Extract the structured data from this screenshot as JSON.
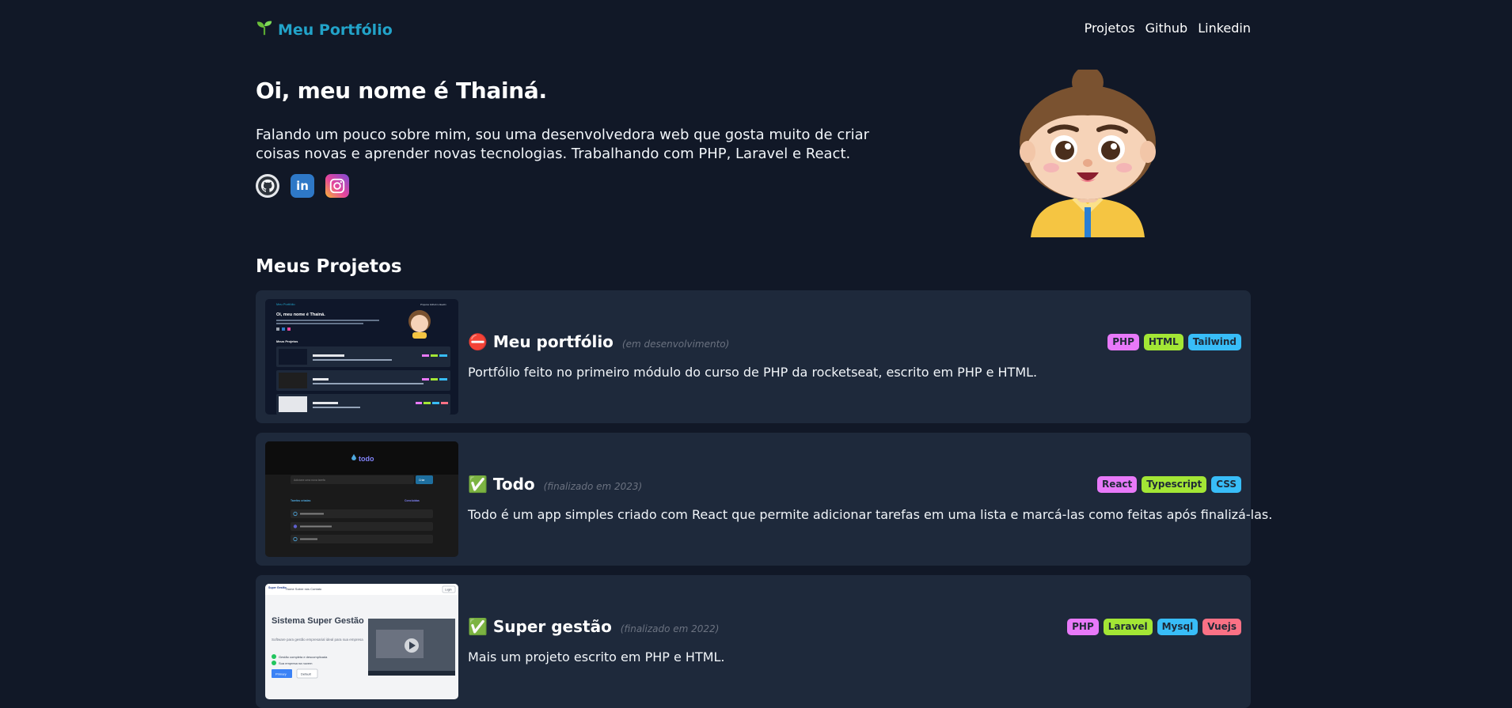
{
  "header": {
    "logo_text": "Meu Portfólio",
    "logo_icon": "seedling-icon",
    "nav": [
      {
        "label": "Projetos"
      },
      {
        "label": "Github"
      },
      {
        "label": "Linkedin"
      }
    ]
  },
  "hero": {
    "title": "Oi, meu nome é Thainá.",
    "description": "Falando um pouco sobre mim, sou uma desenvolvedora web que gosta muito de criar coisas novas e aprender novas tecnologias. Trabalhando com PHP, Laravel e React.",
    "socials": [
      {
        "icon": "github-icon"
      },
      {
        "icon": "linkedin-icon",
        "glyph": "in"
      },
      {
        "icon": "instagram-icon"
      }
    ],
    "avatar_icon": "avatar-3d-icon"
  },
  "projects_section": {
    "title": "Meus Projetos",
    "projects": [
      {
        "emoji": "⛔",
        "title": "Meu portfólio",
        "status": "(em desenvolvimento)",
        "description": "Portfólio feito no primeiro módulo do curso de PHP da rocketseat, escrito em PHP e HTML.",
        "tags": [
          {
            "label": "PHP",
            "color": "#e879f9"
          },
          {
            "label": "HTML",
            "color": "#a3e635"
          },
          {
            "label": "Tailwind",
            "color": "#38bdf8"
          }
        ]
      },
      {
        "emoji": "✅",
        "title": "Todo",
        "status": "(finalizado em 2023)",
        "description": "Todo é um app simples criado com React que permite adicionar tarefas em uma lista e marcá-las como feitas após finalizá-las.",
        "tags": [
          {
            "label": "React",
            "color": "#e879f9"
          },
          {
            "label": "Typescript",
            "color": "#a3e635"
          },
          {
            "label": "CSS",
            "color": "#38bdf8"
          }
        ]
      },
      {
        "emoji": "✅",
        "title": "Super gestão",
        "status": "(finalizado em 2022)",
        "description": "Mais um projeto escrito em PHP e HTML.",
        "tags": [
          {
            "label": "PHP",
            "color": "#e879f9"
          },
          {
            "label": "Laravel",
            "color": "#a3e635"
          },
          {
            "label": "Mysql",
            "color": "#38bdf8"
          },
          {
            "label": "Vuejs",
            "color": "#fb7185"
          }
        ]
      }
    ]
  },
  "thumbnails": {
    "portfolio": {
      "logo": "Meu Portfólio",
      "nav": "Projetos  Github  Linkedin",
      "title": "Oi, meu nome é Thainá.",
      "section": "Meus Projetos"
    },
    "todo": {
      "logo": "todo",
      "input_placeholder": "Adicione uma nova tarefa",
      "button": "Criar",
      "created": "Tarefas criadas",
      "done": "Concluídas"
    },
    "supergestao": {
      "brand": "Super Gestão",
      "nav": "Home   Sobre nós   Contato",
      "login": "Login",
      "title": "Sistema Super Gestão",
      "subtitle": "Software para gestão empresarial ideal para sua empresa",
      "check1": "Gestão completa e descomplicada",
      "check2": "Sua empresa na nuvem",
      "btn1": "Primary",
      "btn2": "Default"
    }
  }
}
